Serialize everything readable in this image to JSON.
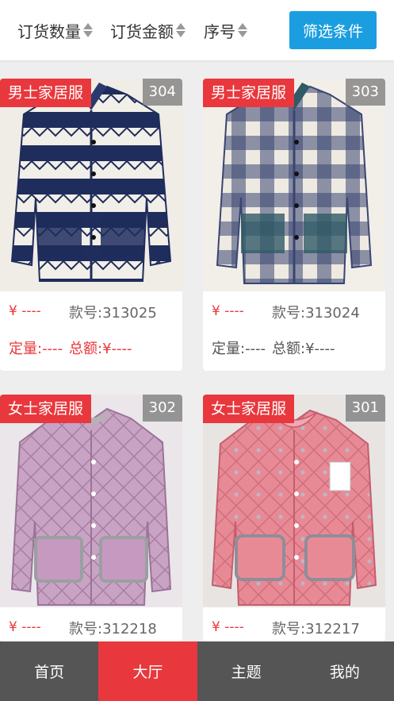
{
  "colors": {
    "accent_blue": "#1b9ee0",
    "tag_red": "#e8383d",
    "price_red": "#e8383d",
    "nav_bg": "#555555",
    "nav_active": "#e8383d"
  },
  "sort_bar": {
    "items": [
      {
        "label": "订货数量",
        "icon": "sort-arrows-icon"
      },
      {
        "label": "订货金额",
        "icon": "sort-arrows-icon"
      },
      {
        "label": "序号",
        "icon": "sort-arrows-icon"
      }
    ],
    "filter_label": "筛选条件"
  },
  "products": [
    {
      "tag": "男士家居服",
      "number": "304",
      "price": "¥ ----",
      "code": "款号:313025",
      "qty": "定量:----",
      "total": "总额:¥----",
      "stats_red": true
    },
    {
      "tag": "男士家居服",
      "number": "303",
      "price": "¥ ----",
      "code": "款号:313024",
      "qty": "定量:----",
      "total": "总额:¥----",
      "stats_red": false
    },
    {
      "tag": "女士家居服",
      "number": "302",
      "price": "¥ ----",
      "code": "款号:312218"
    },
    {
      "tag": "女士家居服",
      "number": "301",
      "price": "¥ ----",
      "code": "款号:312217"
    }
  ],
  "bottom_nav": [
    {
      "label": "首页",
      "active": false
    },
    {
      "label": "大厅",
      "active": true
    },
    {
      "label": "主题",
      "active": false
    },
    {
      "label": "我的",
      "active": false
    }
  ]
}
